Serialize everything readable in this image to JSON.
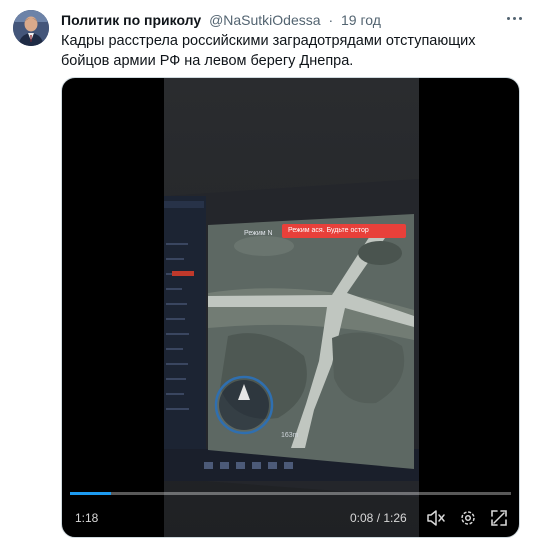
{
  "tweet": {
    "author_name": "Политик по приколу",
    "handle": "@NaSutkiOdessa",
    "separator": "·",
    "time": "19 год",
    "text": "Кадры расстрела российскими заградотрядами отступающих бойцов армии РФ на левом берегу Днепра."
  },
  "video": {
    "overlay_left": "1:18",
    "time_display": "0:08 / 1:26",
    "progress": 0.093,
    "screen_mode_label": "Режим N",
    "screen_warning": "Режим ася. Будьте остор",
    "screen_height": "163m"
  },
  "colors": {
    "accent": "#1d9bf0",
    "warning": "#e8403a"
  },
  "icons": [
    "more-icon",
    "volume-muted-icon",
    "settings-icon",
    "fullscreen-icon"
  ]
}
